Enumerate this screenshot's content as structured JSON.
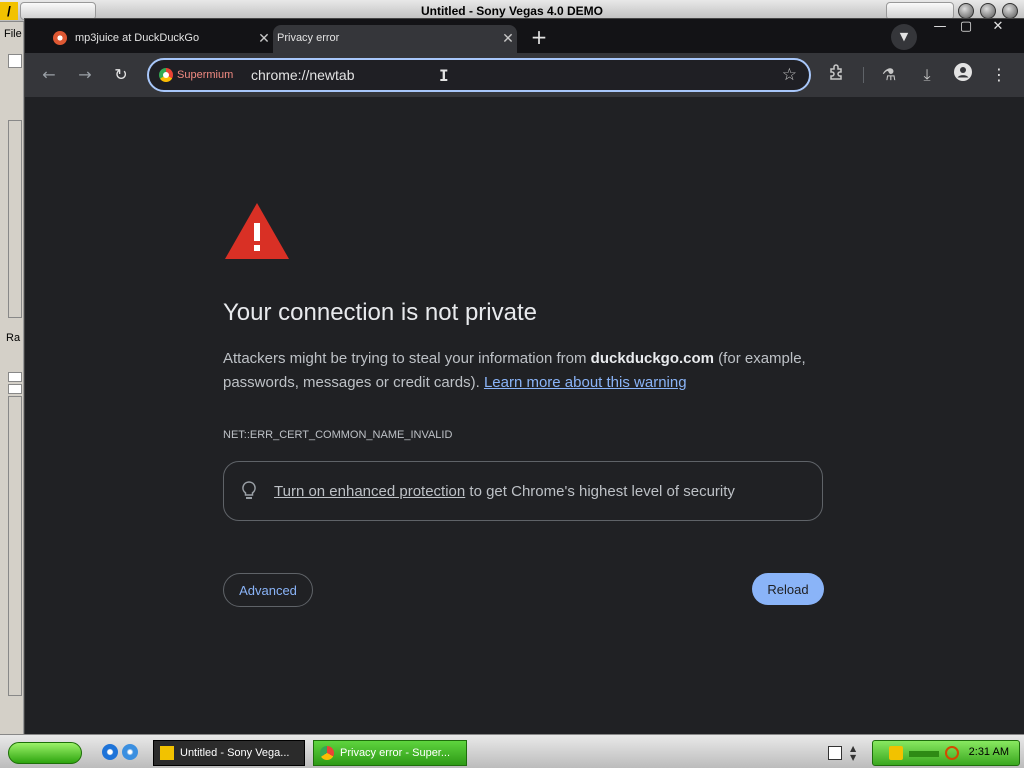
{
  "background_app": {
    "title": "Untitled - Sony Vegas 4.0 DEMO",
    "menu_file": "File",
    "side_label": "Ra"
  },
  "browser": {
    "tabs": [
      {
        "title": "mp3juice at DuckDuckGo",
        "close": "✕"
      },
      {
        "title": "Privacy error",
        "close": "✕"
      }
    ],
    "new_tab": "+",
    "window_controls": {
      "minimize": "—",
      "maximize": "▢",
      "close": "✕"
    },
    "omnibox": {
      "browser_name": "Supermium",
      "url": "chrome://newtab",
      "cursor": "I"
    }
  },
  "page": {
    "heading": "Your connection is not private",
    "body_prefix": "Attackers might be trying to steal your information from ",
    "domain": "duckduckgo.com",
    "body_suffix": " (for example, passwords, messages or credit cards). ",
    "learn_more": "Learn more about this warning",
    "error_code": "NET::ERR_CERT_COMMON_NAME_INVALID",
    "protection_link": "Turn on enhanced protection",
    "protection_suffix": " to get Chrome's highest level of security",
    "advanced_button": "Advanced",
    "reload_button": "Reload",
    "colors": {
      "accent": "#8ab4f8",
      "warning_red": "#d93025",
      "background": "#202124"
    }
  },
  "taskbar": {
    "tasks": [
      {
        "label": "Untitled - Sony Vega..."
      },
      {
        "label": "Privacy error - Super..."
      }
    ],
    "clock": "2:31 AM"
  }
}
